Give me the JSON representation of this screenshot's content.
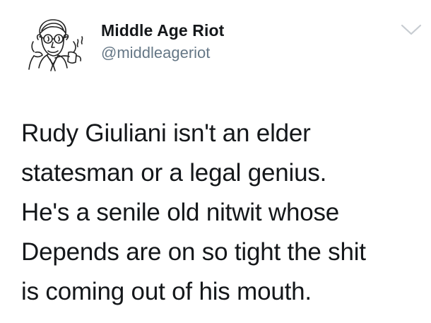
{
  "account": {
    "display_name": "Middle Age Riot",
    "handle": "@middleageriot",
    "avatar_icon": "vintage-man-pipe-icon"
  },
  "menu": {
    "icon": "chevron-down-icon",
    "icon_color": "#c7ccd1"
  },
  "tweet": {
    "lines": [
      "Rudy Giuliani isn't an elder",
      "statesman or a legal genius.",
      "He's a senile old nitwit whose",
      "Depends are on so tight the shit",
      "is coming out of his mouth."
    ]
  },
  "colors": {
    "text": "#14171a",
    "secondary_text": "#657786",
    "background": "#ffffff"
  }
}
